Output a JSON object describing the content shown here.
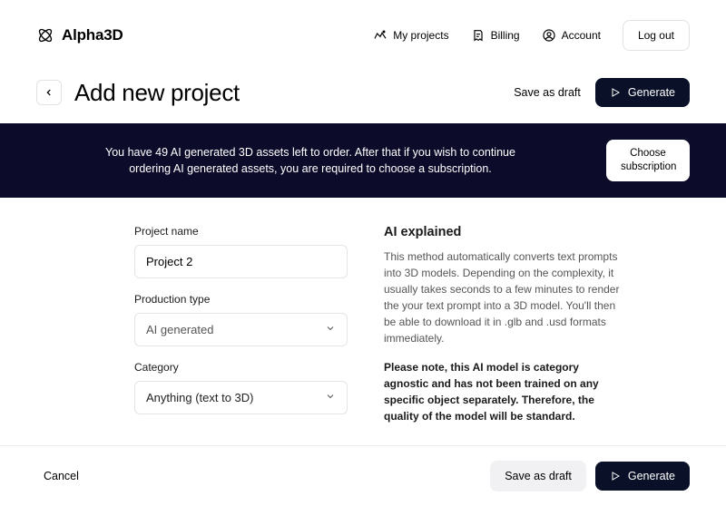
{
  "logo": {
    "text": "Alpha3D"
  },
  "nav": {
    "my_projects": "My projects",
    "billing": "Billing",
    "account": "Account",
    "logout": "Log out"
  },
  "title": {
    "heading": "Add new project",
    "save_draft": "Save as draft",
    "generate": "Generate"
  },
  "banner": {
    "text": "You have 49 AI generated 3D assets left to order. After that if you wish to continue ordering AI generated assets, you are required to choose a subscription.",
    "choose_line1": "Choose",
    "choose_line2": "subscription"
  },
  "form": {
    "project_name_label": "Project name",
    "project_name_value": "Project 2",
    "production_type_label": "Production type",
    "production_type_value": "AI generated",
    "category_label": "Category",
    "category_value": "Anything (text to 3D)"
  },
  "ai": {
    "heading": "AI explained",
    "para": "This method automatically converts text prompts into 3D models. Depending on the complexity, it usually takes seconds to a few minutes to render the your text prompt into a 3D model. You'll then be able to download it in .glb and .usd formats immediately.",
    "note": "Please note, this AI model is category agnostic and has not been trained on any specific object separately. Therefore, the quality of the model will be standard."
  },
  "footer": {
    "cancel": "Cancel",
    "save_draft": "Save as draft",
    "generate": "Generate"
  }
}
